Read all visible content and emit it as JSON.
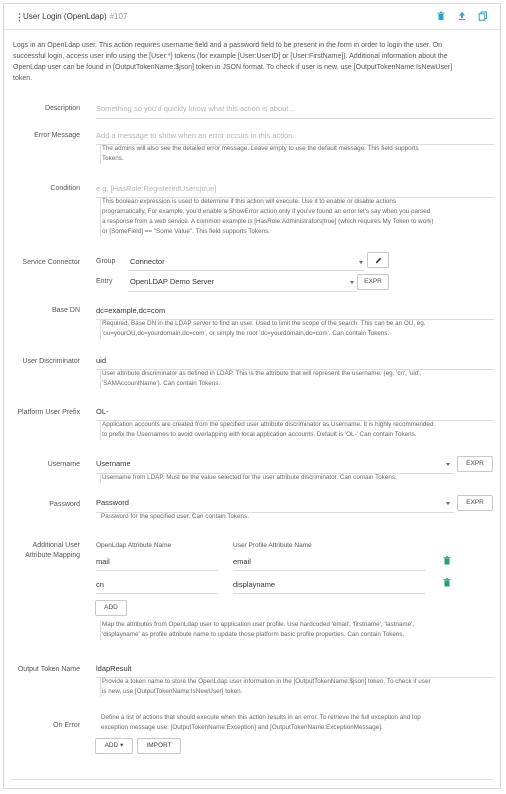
{
  "header": {
    "title": "User Login (OpenLdap)",
    "id": "#107",
    "colors": {
      "icons": "#2aa3c9"
    }
  },
  "intro": [
    "Logs in an OpenLdap user. This action requires username field and a password field to be present in the form in order to login the user. On",
    "successful login, access user info using the [User:*] tokens (for example [User:UserID] or [User:FirstName]). Additional information about the",
    "OpenLdap user can be found in [OutputTokenName:$json] token in JSON format. To check if user is new, use [OutputTokenName:IsNewUser]",
    "token."
  ],
  "description": {
    "label": "Description",
    "placeholder": "Something so you'd quickly know what this action is about..."
  },
  "error_message": {
    "label": "Error Message",
    "placeholder": "Add a message to show when an error occurs in this action.",
    "help": [
      "The admins will also see the detailed error message. Leave empty to use the default message. This field supports",
      "Tokens."
    ]
  },
  "condition": {
    "label": "Condition",
    "placeholder": "e.g. [HasRole:RegisteredUsers|true]",
    "help": [
      "This boolean expression is used to determine if this action will execute. Use it to enable or disable actions",
      "programatically. For example, you'd enable a ShowError action only if you've found an error let's say when you parsed",
      "a response from a web service. A common example is [HasRole:Administrators|true] (which requires My Token to work)",
      "or [SomeField] == \"Some Value\". This field supports Tokens."
    ]
  },
  "service_connector": {
    "label": "Service Connector",
    "group_label": "Group",
    "group_value": "Connector",
    "entry_label": "Entry",
    "entry_value": "OpenLDAP Demo Server",
    "expr_label": "EXPR",
    "edit_icon": "pencil-icon"
  },
  "base_dn": {
    "label": "Base DN",
    "value": "dc=example,dc=com",
    "help": [
      "Required. Base DN in the LDAP server to find an user. Used to limit the scope of the search. This can be an OU, eg.",
      "'ou=yourOU,dc=yourdomain,dc=com', or simply the root 'dc=yourdomain,dc=com'. Can contain Tokens."
    ]
  },
  "user_discriminator": {
    "label": "User Discriminator",
    "value": "uid",
    "help": [
      "User attribute discriminator as defined in LDAP. This is the attribute that will represent the username. (eg. 'cn', 'uid',",
      "'SAMAccountName'). Can contain Tokens."
    ]
  },
  "platform_user_prefix": {
    "label": "Platform User Prefix",
    "value": "OL-",
    "help": [
      "Application accounts are created from the specified user attribute discriminator as Username. It is highly recommended",
      "to prefix the Usernames to avoid overlapping with local application accounts. Default is 'OL-' Can contain Tokens."
    ]
  },
  "username": {
    "label": "Username",
    "value": "Username",
    "expr_label": "EXPR",
    "help": [
      "Username from LDAP. Must be the value selected for the user attribute discriminator. Can contain Tokens."
    ]
  },
  "password": {
    "label": "Password",
    "value": "Password",
    "expr_label": "EXPR",
    "help": [
      "Password for the specified user. Can contain Tokens."
    ]
  },
  "attribute_mapping": {
    "label_line1": "Additional User",
    "label_line2": "Attribute Mapping",
    "col_ldap": "OpenLdap Attribute Name",
    "col_profile": "User Profile Attribute Name",
    "rows": [
      {
        "ldap": "mail",
        "profile": "email"
      },
      {
        "ldap": "cn",
        "profile": "displayname"
      }
    ],
    "add_label": "ADD",
    "help": [
      "Map the attributes from OpenLdap user to application user profile. Use hardcoded 'email', 'firstname', 'lastname',",
      "'displayname' as profile attribute name to update those platform basic profile properties. Can contain Tokens."
    ]
  },
  "output_token": {
    "label": "Output Token Name",
    "value": "ldapResult",
    "help": [
      "Provide a token name to store the OpenLdap user information in the [OutputTokenName:$json] token. To check if user",
      "is new, use [OutputTokenName:IsNewUser] token."
    ]
  },
  "on_error": {
    "label": "On Error",
    "help": [
      "Define a list of actions that should execute when this action results in an error. To retrieve the full exception and top",
      "exception message use: [OutputTokenName:Exception] and [OutputTokenName:ExceptionMessage]."
    ],
    "add_label": "ADD ▾",
    "import_label": "IMPORT"
  }
}
